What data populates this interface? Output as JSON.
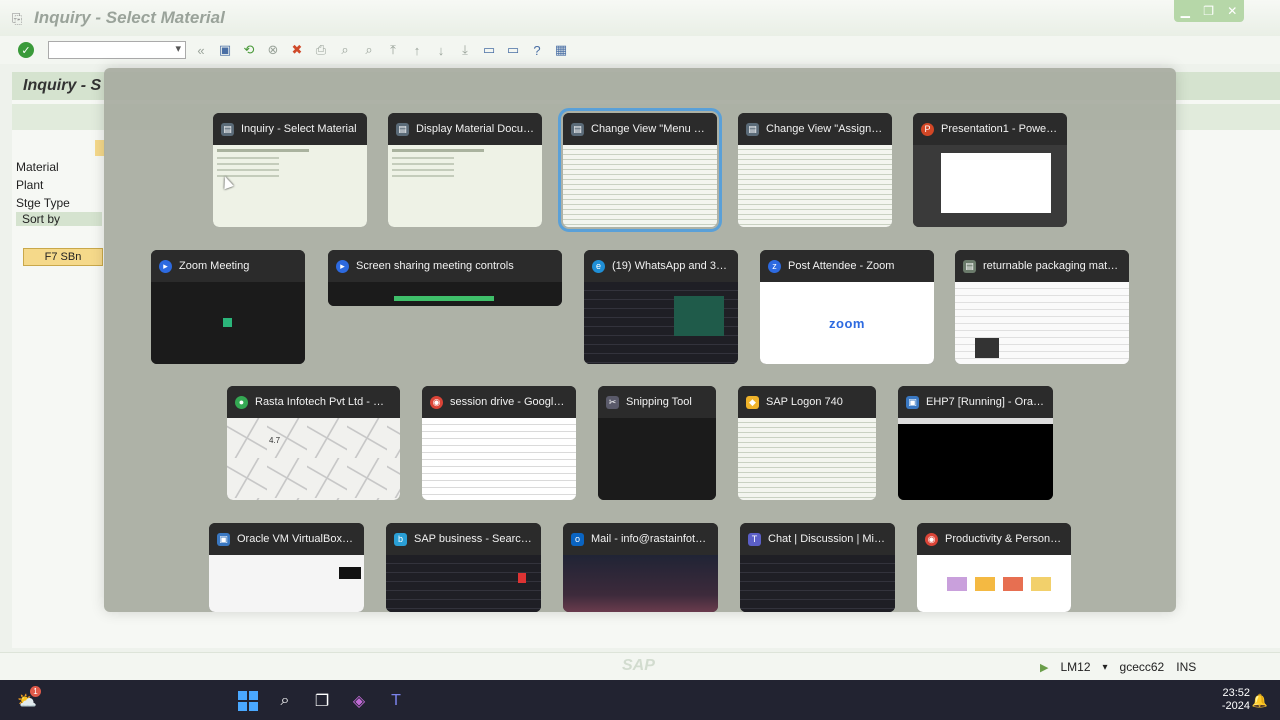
{
  "sap": {
    "window_title": "Inquiry - Select Material",
    "screen_title": "Inquiry - S",
    "fields": {
      "material": "Material",
      "plant": "Plant",
      "storage_type": "Stge Type",
      "sort_by": "Sort by"
    },
    "f7_button": "F7 SBn",
    "status": {
      "transaction": "LM12",
      "server": "gcecc62",
      "mode": "INS"
    },
    "logo": "SAP"
  },
  "switcher": {
    "windows": [
      {
        "title": "Inquiry - Select Material",
        "icon": "sap-gui-icon",
        "selected": false
      },
      {
        "title": "Display Material Docum...",
        "icon": "sap-gui-icon",
        "selected": false
      },
      {
        "title": "Change View \"Menu Sel...",
        "icon": "sap-gui-icon",
        "selected": true
      },
      {
        "title": "Change View \"Assignm...",
        "icon": "sap-gui-icon",
        "selected": false
      },
      {
        "title": "Presentation1 - PowerPo...",
        "icon": "powerpoint-icon",
        "selected": false
      },
      {
        "title": "Zoom Meeting",
        "icon": "zoom-icon",
        "selected": false
      },
      {
        "title": "Screen sharing meeting controls",
        "icon": "zoom-icon",
        "selected": false
      },
      {
        "title": "(19) WhatsApp and 39...",
        "icon": "edge-icon",
        "selected": false
      },
      {
        "title": "Post Attendee - Zoom",
        "icon": "zoom-app-icon",
        "selected": false
      },
      {
        "title": "returnable packaging mater...",
        "icon": "document-icon",
        "selected": false
      },
      {
        "title": "Rasta Infotech Pvt Ltd - Goo...",
        "icon": "maps-icon",
        "selected": false
      },
      {
        "title": "session drive - Google...",
        "icon": "chrome-icon",
        "selected": false
      },
      {
        "title": "Snipping Tool",
        "icon": "snipping-tool-icon",
        "selected": false
      },
      {
        "title": "SAP Logon 740",
        "icon": "sap-logon-icon",
        "selected": false
      },
      {
        "title": "EHP7 [Running] - Oracle...",
        "icon": "virtualbox-icon",
        "selected": false
      },
      {
        "title": "Oracle VM VirtualBox M...",
        "icon": "virtualbox-icon",
        "selected": false
      },
      {
        "title": "SAP business - Search R...",
        "icon": "bing-icon",
        "selected": false
      },
      {
        "title": "Mail - info@rastainfotec...",
        "icon": "outlook-icon",
        "selected": false
      },
      {
        "title": "Chat | Discussion | Micr...",
        "icon": "teams-icon",
        "selected": false
      },
      {
        "title": "Productivity & Personali...",
        "icon": "chrome-icon",
        "selected": false
      }
    ],
    "thumb_texts": {
      "zoom_logo": "zoom",
      "map_rating": "4.7"
    }
  },
  "taskbar": {
    "notification_count": "1",
    "time": "23:52",
    "date_fragment": "-2024"
  }
}
